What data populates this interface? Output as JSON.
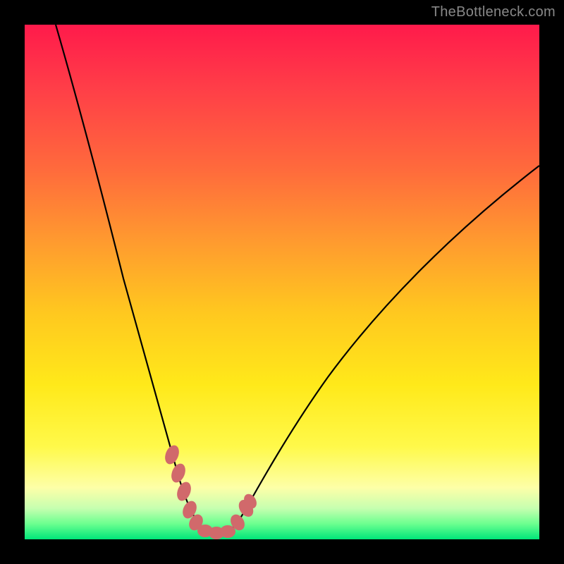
{
  "watermark": "TheBottleneck.com",
  "colors": {
    "page_bg": "#000000",
    "gradient": [
      "#ff1a4b",
      "#ff3d48",
      "#ff6a3c",
      "#ff9a2f",
      "#ffc81f",
      "#ffe91a",
      "#fff94a",
      "#fdffa8",
      "#c6ffb0",
      "#6bff8f",
      "#00e67a"
    ],
    "curve_stroke": "#000000",
    "highlight": "#d1696b"
  },
  "chart_data": {
    "type": "line",
    "title": "",
    "xlabel": "",
    "ylabel": "",
    "xlim": [
      0,
      100
    ],
    "ylim": [
      0,
      100
    ],
    "grid": false,
    "legend": false,
    "series": [
      {
        "name": "bottleneck-curve",
        "x": [
          6,
          8,
          10,
          12,
          14,
          16,
          18,
          20,
          22,
          24,
          26,
          28,
          30,
          31,
          32,
          33,
          34,
          35,
          36,
          37,
          38,
          39,
          40,
          42,
          45,
          50,
          55,
          60,
          65,
          70,
          75,
          80,
          85,
          90,
          95,
          100
        ],
        "y": [
          100,
          92,
          84,
          76,
          68,
          60,
          52,
          44,
          37,
          30,
          23,
          17,
          11,
          8,
          6,
          4,
          2.5,
          1.5,
          1,
          1,
          1.3,
          2,
          3,
          5,
          9,
          16,
          23,
          30,
          36,
          42,
          48,
          54,
          59,
          64,
          69,
          73
        ]
      }
    ],
    "highlight_segments": [
      {
        "name": "left-edge",
        "x_range": [
          28,
          33
        ],
        "approx_y_range": [
          17,
          4
        ]
      },
      {
        "name": "floor",
        "x_range": [
          33,
          39
        ],
        "approx_y_range": [
          1,
          2
        ]
      },
      {
        "name": "right-edge",
        "x_range": [
          39,
          43
        ],
        "approx_y_range": [
          2,
          6
        ]
      }
    ],
    "annotations": []
  }
}
